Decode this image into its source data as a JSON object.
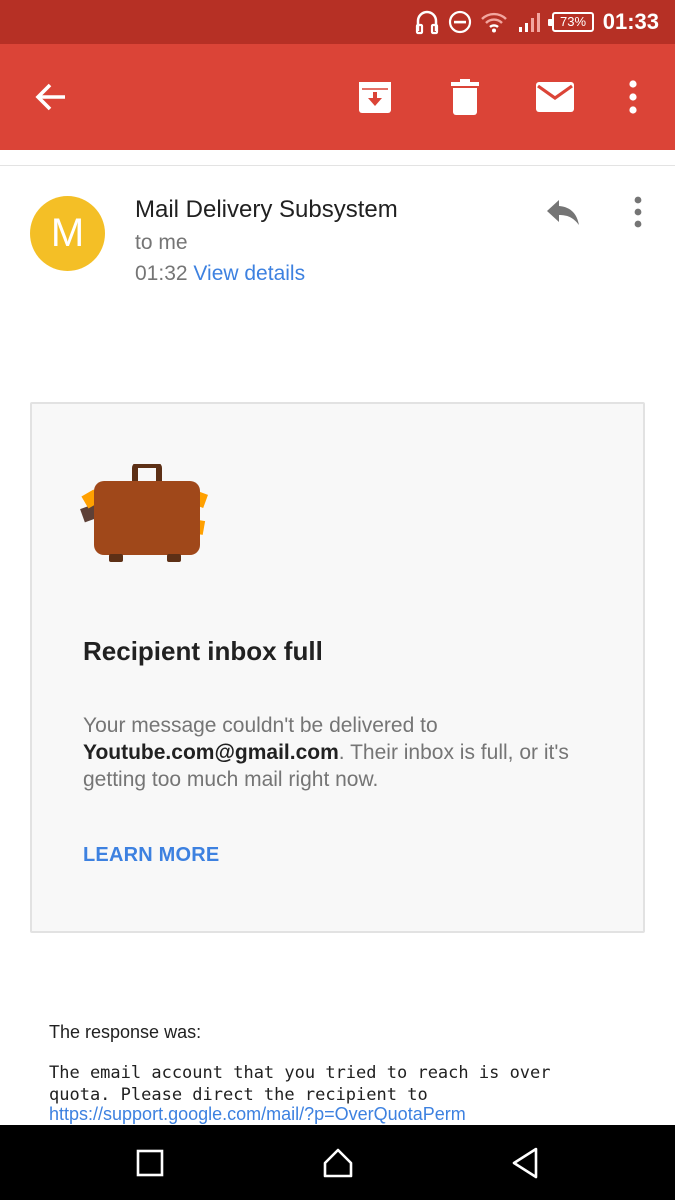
{
  "status_bar": {
    "time": "01:33",
    "battery": "73%",
    "icons": [
      "headset-icon",
      "do-not-disturb-icon",
      "wifi-icon",
      "signal-icon"
    ]
  },
  "app_bar": {
    "icons": [
      "back-arrow-icon",
      "archive-icon",
      "delete-icon",
      "mark-unread-icon",
      "more-vert-icon"
    ],
    "color": "#db4437"
  },
  "email": {
    "avatar_letter": "M",
    "avatar_color": "#f4bf26",
    "sender": "Mail Delivery Subsystem",
    "recipient": "to me",
    "time": "01:32",
    "view_details": "View details"
  },
  "card": {
    "title": "Recipient inbox full",
    "msg_prefix": "Your message couldn't be delivered to",
    "msg_address": "Youtube.com@gmail.com",
    "msg_suffix": ". Their inbox is full, or it's getting too much mail right now.",
    "action": "LEARN MORE"
  },
  "response": {
    "label": "The response was:",
    "body": "The email account that you tried to reach is over\nquota. Please direct the recipient to",
    "link": "https://support.google.com/mail/?p=OverQuotaPerm"
  },
  "nav_bar": {
    "icons": [
      "recents-square-icon",
      "home-icon",
      "back-triangle-icon"
    ]
  }
}
